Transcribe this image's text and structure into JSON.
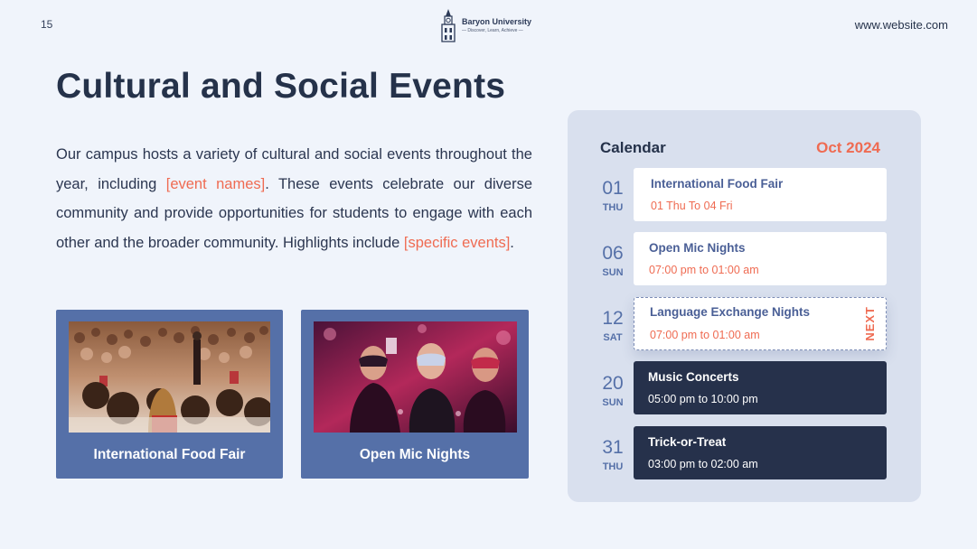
{
  "header": {
    "slide_number": "15",
    "logo_name": "Baryon University",
    "logo_tagline": "— Discover, Learn, Achieve —",
    "website": "www.website.com"
  },
  "main": {
    "title": "Cultural and Social Events",
    "intro_part1": "Our campus hosts a variety of cultural and social events throughout the year, including ",
    "intro_hl1": "[event names]",
    "intro_part2": ". These events celebrate our diverse community and provide opportunities for students to engage with each other and the broader community. Highlights include ",
    "intro_hl2": "[specific events]",
    "intro_part3": ".",
    "cards": [
      {
        "caption": "International Food Fair"
      },
      {
        "caption": "Open Mic Nights"
      }
    ]
  },
  "calendar": {
    "title": "Calendar",
    "month": "Oct  2024",
    "next_label": "NEXT",
    "events": [
      {
        "day": "01",
        "weekday": "THU",
        "title": "International Food Fair",
        "time": "01 Thu To 04 Fri"
      },
      {
        "day": "06",
        "weekday": "SUN",
        "title": "Open Mic Nights",
        "time": "07:00 pm to 01:00 am"
      },
      {
        "day": "12",
        "weekday": "SAT",
        "title": "Language Exchange Nights",
        "time": "07:00 pm to 01:00 am"
      },
      {
        "day": "20",
        "weekday": "SUN",
        "title": "Music Concerts",
        "time": "05:00 pm to 10:00 pm"
      },
      {
        "day": "31",
        "weekday": "THU",
        "title": "Trick-or-Treat",
        "time": "03:00 pm to 02:00 am"
      }
    ]
  },
  "colors": {
    "accent": "#ef6b52",
    "card_blue": "#5570a8",
    "navy": "#26314b",
    "panel": "#d9e0ee",
    "background": "#f0f4fb"
  }
}
